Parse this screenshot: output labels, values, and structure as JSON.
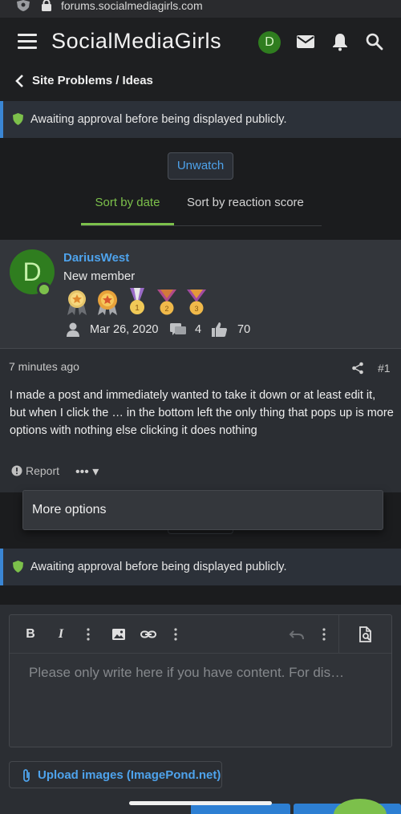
{
  "browser": {
    "url": "forums.socialmediagirls.com"
  },
  "header": {
    "brand": "SocialMediaGirls",
    "avatar_letter": "D"
  },
  "breadcrumb": {
    "label": "Site Problems / Ideas"
  },
  "notices": {
    "approval_top": "Awaiting approval before being displayed publicly.",
    "approval_bottom": "Awaiting approval before being displayed publicly."
  },
  "thread_controls": {
    "unwatch_label": "Unwatch",
    "tabs": [
      {
        "label": "Sort by date",
        "active": true
      },
      {
        "label": "Sort by reaction score",
        "active": false
      }
    ]
  },
  "post": {
    "author": {
      "name": "DariusWest",
      "avatar_letter": "D",
      "title": "New member",
      "joined": "Mar 26, 2020",
      "messages": "4",
      "reactions": "70"
    },
    "time": "7 minutes ago",
    "number": "#1",
    "body": "I made a post and immediately wanted to take it down or at least edit it, but when I click the … in the bottom left the only thing that pops up is more options with nothing else clicking it does nothing",
    "report_label": "Report",
    "more_label": "••• ▾"
  },
  "dropdown": {
    "item": "More options"
  },
  "composer": {
    "placeholder": "Please only write here if you have content. For dis…",
    "bold": "B",
    "italic": "I",
    "upload_label": "Upload images (ImagePond.net)"
  },
  "colors": {
    "accent_blue": "#4ea3ec",
    "accent_green": "#7cc04b",
    "notice_border": "#3a86d4"
  }
}
